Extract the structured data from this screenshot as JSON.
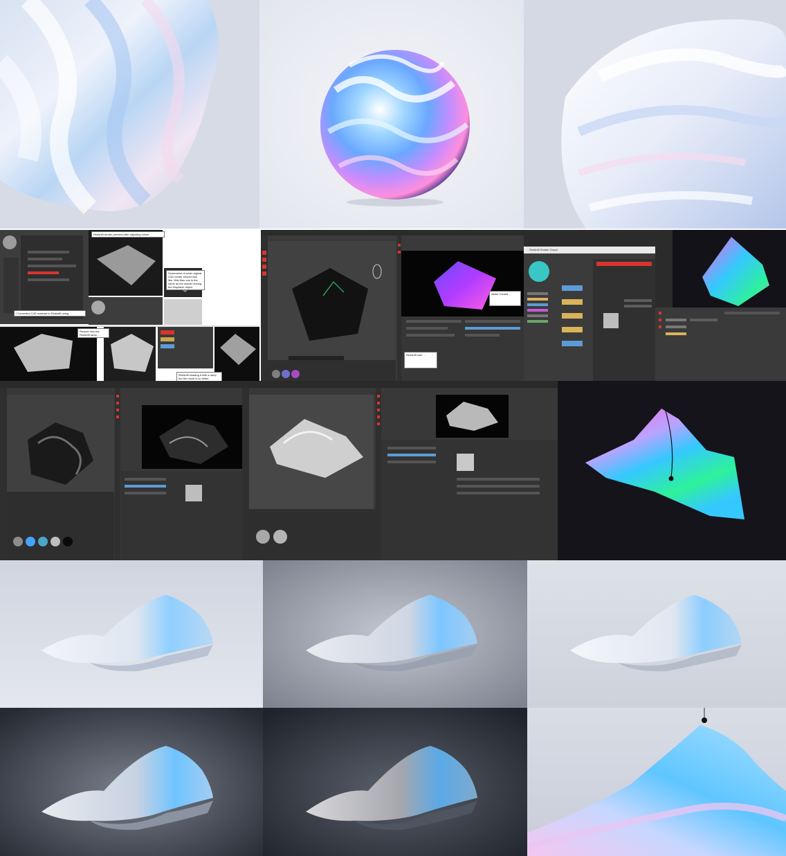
{
  "collage": {
    "row1": {
      "left": {
        "kind": "render",
        "subject": "iridescent wavy blob close-up"
      },
      "center": {
        "kind": "render",
        "subject": "iridescent sphere"
      },
      "right": {
        "kind": "render",
        "subject": "white wavy blob close-up"
      }
    },
    "row2": {
      "a_notes": [
        "Redshift render preview after adjusting colors",
        "Screenshot of what original C4D render should look like. Mist Max one is the same as the shader driving the Displacer object",
        "I Converted C4D material to Redshift using ...",
        "Rework how the Redshift ramp ...",
        "Redshift shading it with a ramp but the result is so better"
      ],
      "b_notes": [
        "Noise Control ... ",
        "Redshift user ... "
      ],
      "c_window_title": "Redshift Shader Graph"
    },
    "row4": [
      "soft light render",
      "grey background render",
      "white background render"
    ],
    "row5": [
      "dark background render",
      "dark background render",
      "iridescent close-up render"
    ]
  },
  "colors": {
    "ui_bg": "#3a3a3a",
    "ui_dark": "#2b2b2b",
    "accent_red": "#d8352e",
    "viewport_black": "#0b0b0b",
    "gradient_pink": "#ff5ee3",
    "gradient_cyan": "#35c8ff",
    "gradient_green": "#2df29a"
  }
}
